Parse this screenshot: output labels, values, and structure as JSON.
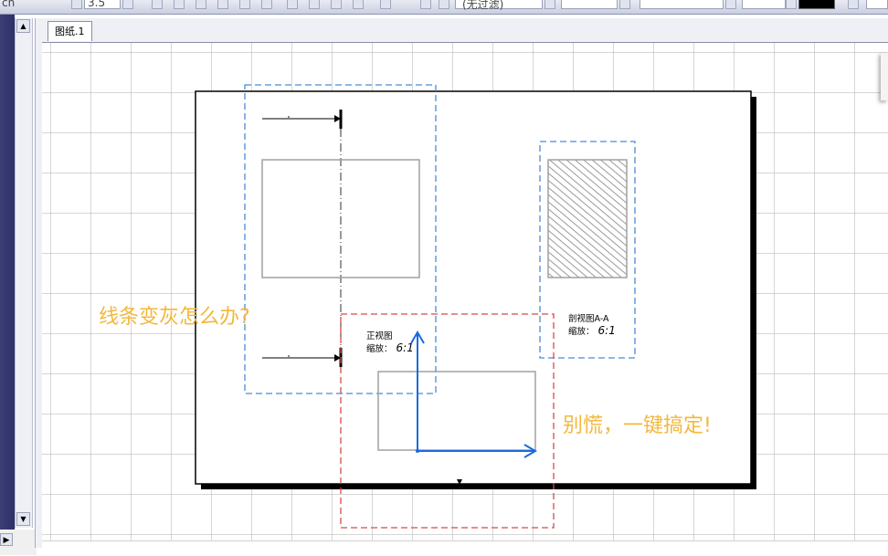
{
  "toolbar": {
    "font_name_partial": "ch",
    "font_size_partial": "3.5",
    "style_box_text": "(无过滤)",
    "color_swatch": "#000000"
  },
  "sheet": {
    "tab_label": "图纸.1"
  },
  "views": {
    "front": {
      "name": "正视图",
      "scale_label": "缩放：",
      "scale_value": "6:1"
    },
    "section": {
      "name": "剖视图A-A",
      "scale_label": "缩放：",
      "scale_value": "6:1"
    }
  },
  "overlays": {
    "question": "线条变灰怎么办?",
    "answer": "别慌，一键搞定!"
  },
  "colors": {
    "frame_border": "#000000",
    "blue_dashed": "#4a8ad8",
    "red_dashed": "#d84a4a",
    "overlay_text": "#f4b73a",
    "axis_blue": "#1a6adf",
    "grey_geometry": "#a0a0a0"
  },
  "icons": {
    "scroll_up": "▲",
    "scroll_down": "▼",
    "scroll_right": "▶"
  }
}
